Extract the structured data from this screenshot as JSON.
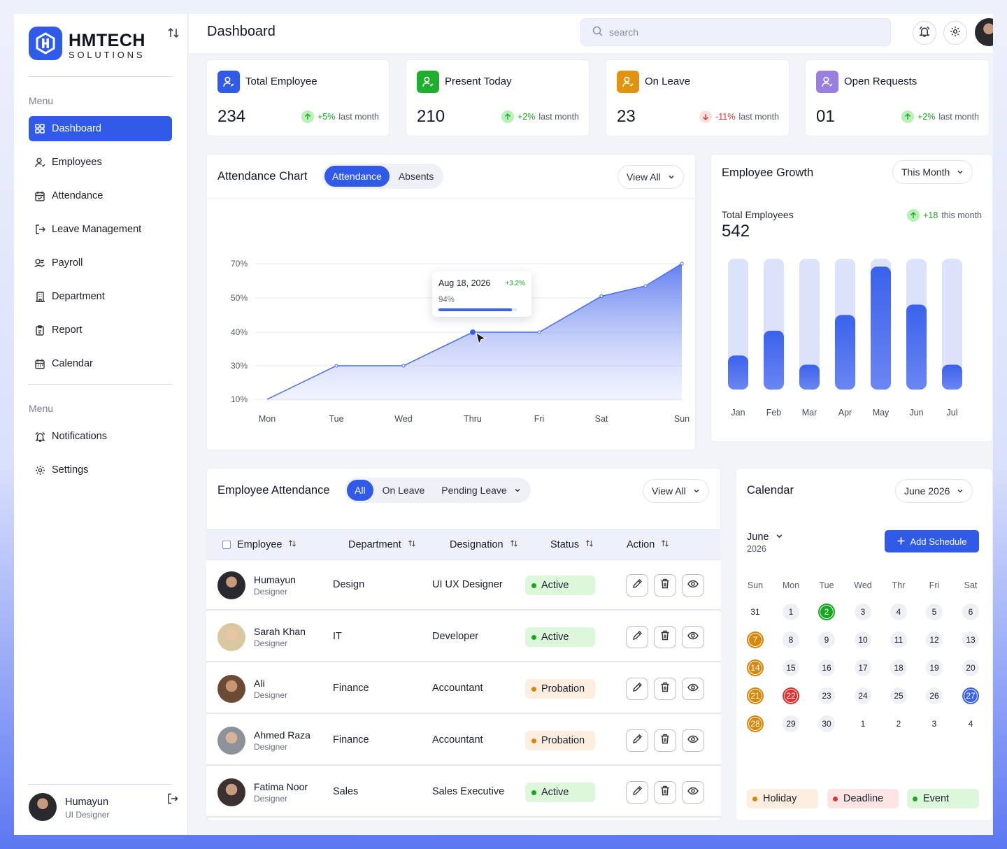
{
  "brand": {
    "name": "HMTECH",
    "sub": "SOLUTIONS"
  },
  "sidebar": {
    "menu_heading": "Menu",
    "items": [
      {
        "label": "Dashboard",
        "icon": "grid-icon",
        "active": true
      },
      {
        "label": "Employees",
        "icon": "user-icon"
      },
      {
        "label": "Attendance",
        "icon": "calendar-check-icon"
      },
      {
        "label": "Leave Management",
        "icon": "logout-arrow-icon"
      },
      {
        "label": "Payroll",
        "icon": "payroll-icon"
      },
      {
        "label": "Department",
        "icon": "building-icon"
      },
      {
        "label": "Report",
        "icon": "report-icon"
      },
      {
        "label": "Calendar",
        "icon": "calendar-icon"
      }
    ],
    "menu_heading_2": "Menu",
    "items_2": [
      {
        "label": "Notifications",
        "icon": "bell-icon"
      },
      {
        "label": "Settings",
        "icon": "gear-icon"
      }
    ],
    "user": {
      "name": "Humayun",
      "role": "UI Designer"
    }
  },
  "topbar": {
    "title": "Dashboard",
    "search_placeholder": "search"
  },
  "stats": [
    {
      "label": "Total Employee",
      "value": "234",
      "change": "+5%",
      "suffix": "last month",
      "direction": "up",
      "color": "#2f5be8"
    },
    {
      "label": "Present Today",
      "value": "210",
      "change": "+2%",
      "suffix": "last month",
      "direction": "up",
      "color": "#1fae2e"
    },
    {
      "label": "On Leave",
      "value": "23",
      "change": "-11%",
      "suffix": "last month",
      "direction": "down",
      "color": "#e0930f"
    },
    {
      "label": "Open Requests",
      "value": "01",
      "change": "+2%",
      "suffix": "last month",
      "direction": "up",
      "color": "#9a7fe0"
    }
  ],
  "attendance_chart": {
    "title": "Attendance Chart",
    "tabs": [
      "Attendance",
      "Absents"
    ],
    "view_all": "View All",
    "tooltip": {
      "date": "Aug 18, 2026",
      "change": "+3.2%",
      "value": "94%",
      "fill": 0.94
    },
    "chart_data": {
      "type": "area",
      "categories": [
        "Mon",
        "Tue",
        "Wed",
        "Thru",
        "Fri",
        "Sat",
        "Sun"
      ],
      "values": [
        10,
        30,
        30,
        40,
        40,
        51,
        70
      ],
      "extra_point": {
        "after": "Sat",
        "value": 57
      },
      "yticks": [
        "70%",
        "50%",
        "40%",
        "30%",
        "10%"
      ],
      "highlight_index": 3
    }
  },
  "growth": {
    "title": "Employee Growth",
    "period": "This Month",
    "total_label": "Total Employees",
    "total_value": "542",
    "change": "+18",
    "change_suffix": "this month",
    "chart_data": {
      "type": "bar",
      "categories": [
        "Jan",
        "Feb",
        "Mar",
        "Apr",
        "May",
        "Jun",
        "Jul"
      ],
      "values": [
        26,
        45,
        19,
        57,
        94,
        65,
        19
      ],
      "ylim": [
        0,
        100
      ]
    }
  },
  "employee_attendance": {
    "title": "Employee Attendance",
    "tabs": [
      "All",
      "On Leave",
      "Pending Leave"
    ],
    "view_all": "View All",
    "columns": [
      "Employee",
      "Department",
      "Designation",
      "Status",
      "Action"
    ],
    "rows": [
      {
        "name": "Humayun",
        "role": "Designer",
        "department": "Design",
        "designation": "UI UX Designer",
        "status": "Active"
      },
      {
        "name": "Sarah Khan",
        "role": "Designer",
        "department": "IT",
        "designation": "Developer",
        "status": "Active"
      },
      {
        "name": "Ali",
        "role": "Designer",
        "department": "Finance",
        "designation": "Accountant",
        "status": "Probation"
      },
      {
        "name": "Ahmed Raza",
        "role": "Designer",
        "department": "Finance",
        "designation": "Accountant",
        "status": "Probation"
      },
      {
        "name": "Fatima Noor",
        "role": "Designer",
        "department": "Sales",
        "designation": "Sales Executive",
        "status": "Active"
      }
    ],
    "status_colors": {
      "Active": {
        "bg": "#dcf7d9",
        "fg": "#1c1f2b",
        "dot": "#17a821"
      },
      "Probation": {
        "bg": "#fdeee0",
        "fg": "#1c1f2b",
        "dot": "#d9860c"
      }
    }
  },
  "calendar": {
    "title": "Calendar",
    "period": "June 2026",
    "month": "June",
    "year": "2026",
    "add_label": "Add Schedule",
    "weekdays": [
      "Sun",
      "Mon",
      "Tue",
      "Wed",
      "Thr",
      "Fri",
      "Sat"
    ],
    "weeks": [
      [
        "31",
        "1",
        "2",
        "3",
        "4",
        "5",
        "6"
      ],
      [
        "7",
        "8",
        "9",
        "10",
        "11",
        "12",
        "13"
      ],
      [
        "14",
        "15",
        "16",
        "17",
        "18",
        "19",
        "20"
      ],
      [
        "21",
        "22",
        "23",
        "24",
        "25",
        "26",
        "27"
      ],
      [
        "28",
        "29",
        "30",
        "1",
        "2",
        "3",
        "4"
      ]
    ],
    "marks": {
      "0-2": "#17a821",
      "1-0": "#d9860c",
      "2-0": "#d9860c",
      "3-0": "#d9860c",
      "3-1": "#e5302f",
      "3-6": "#3b62ec",
      "4-0": "#d9860c"
    },
    "legend": [
      {
        "label": "Holiday",
        "bg": "#fdeee0",
        "dot": "#d9860c"
      },
      {
        "label": "Deadline",
        "bg": "#fde4e4",
        "dot": "#e5302f"
      },
      {
        "label": "Event",
        "bg": "#dcf7d9",
        "dot": "#17a821"
      }
    ]
  }
}
